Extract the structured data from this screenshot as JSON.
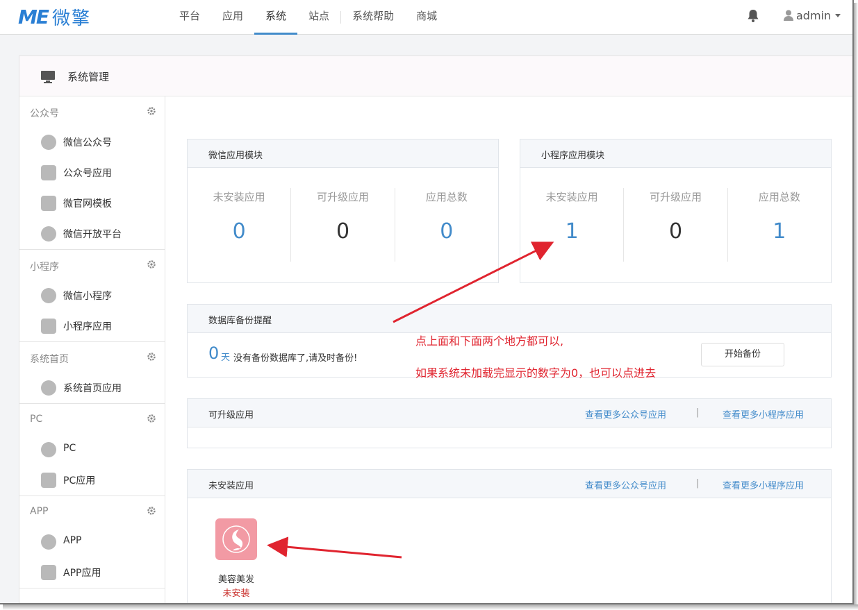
{
  "brand": {
    "logo_me": "ME",
    "logo_cn": "微擎"
  },
  "nav": {
    "items": [
      "平台",
      "应用",
      "系统",
      "站点",
      "系统帮助",
      "商城"
    ],
    "active": "系统",
    "user": "admin"
  },
  "panel": {
    "title": "系统管理"
  },
  "sidebar": {
    "groups": [
      {
        "label": "公众号",
        "items": [
          "微信公众号",
          "公众号应用",
          "微官网模板",
          "微信开放平台"
        ]
      },
      {
        "label": "小程序",
        "items": [
          "微信小程序",
          "小程序应用"
        ]
      },
      {
        "label": "系统首页",
        "items": [
          "系统首页应用"
        ]
      },
      {
        "label": "PC",
        "items": [
          "PC",
          "PC应用"
        ]
      },
      {
        "label": "APP",
        "items": [
          "APP",
          "APP应用"
        ]
      }
    ]
  },
  "wechat_module": {
    "title": "微信应用模块",
    "stats": [
      {
        "label": "未安装应用",
        "value": "0",
        "color": "#428bca"
      },
      {
        "label": "可升级应用",
        "value": "0",
        "color": "#333333"
      },
      {
        "label": "应用总数",
        "value": "0",
        "color": "#428bca"
      }
    ]
  },
  "mini_module": {
    "title": "小程序应用模块",
    "stats": [
      {
        "label": "未安装应用",
        "value": "1",
        "color": "#428bca"
      },
      {
        "label": "可升级应用",
        "value": "0",
        "color": "#333333"
      },
      {
        "label": "应用总数",
        "value": "1",
        "color": "#428bca"
      }
    ]
  },
  "backup": {
    "title": "数据库备份提醒",
    "days": "0",
    "days_unit": "天",
    "message": "没有备份数据库了,请及时备份!",
    "button": "开始备份"
  },
  "upgradable": {
    "title": "可升级应用",
    "link_mp": "查看更多公众号应用",
    "separator": "|",
    "link_mini": "查看更多小程序应用"
  },
  "uninstalled": {
    "title": "未安装应用",
    "link_mp": "查看更多公众号应用",
    "separator": "|",
    "link_mini": "查看更多小程序应用",
    "app_name": "美容美发",
    "app_status": "未安装",
    "app_color": "#f29aa4"
  },
  "annotations": {
    "line1": "点上面和下面两个地方都可以,",
    "line2": "如果系统未加载完显示的数字为0，也可以点进去"
  },
  "colors": {
    "accent": "#428bca",
    "annotation": "#e0242f",
    "status_uninstalled": "#c9302c"
  }
}
